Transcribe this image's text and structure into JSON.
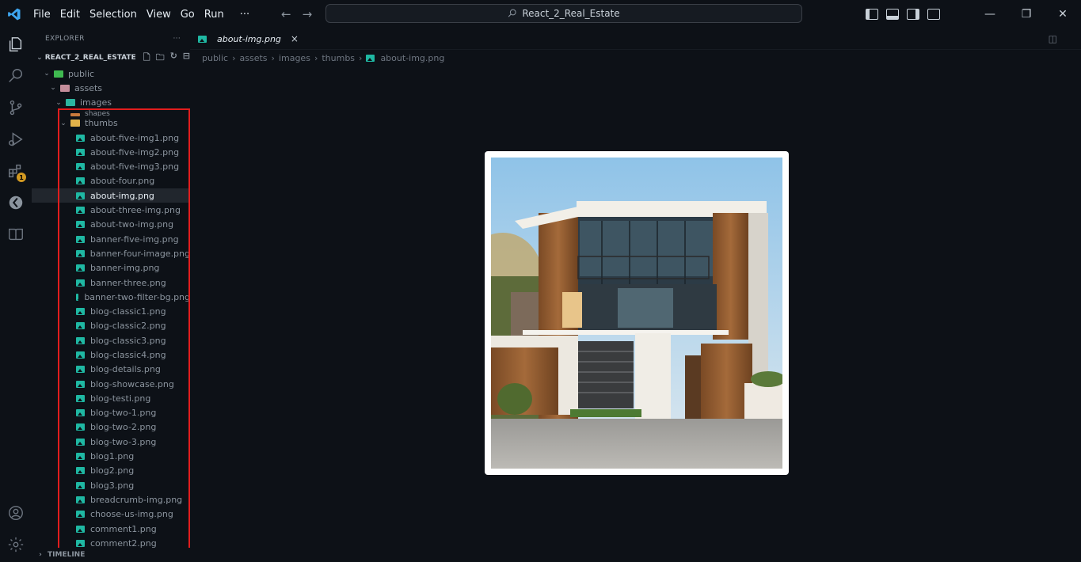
{
  "menu": [
    "File",
    "Edit",
    "Selection",
    "View",
    "Go",
    "Run",
    "···"
  ],
  "search": {
    "text": "React_2_Real_Estate"
  },
  "explorer": {
    "title": "EXPLORER",
    "more": "···",
    "project": "REACT_2_REAL_ESTATE"
  },
  "tree": {
    "public": "public",
    "assets": "assets",
    "images": "images",
    "shapes": "shapes",
    "thumbs": "thumbs",
    "files": [
      "about-five-img1.png",
      "about-five-img2.png",
      "about-five-img3.png",
      "about-four.png",
      "about-img.png",
      "about-three-img.png",
      "about-two-img.png",
      "banner-five-img.png",
      "banner-four-image.png",
      "banner-img.png",
      "banner-three.png",
      "banner-two-filter-bg.png",
      "blog-classic1.png",
      "blog-classic2.png",
      "blog-classic3.png",
      "blog-classic4.png",
      "blog-details.png",
      "blog-showcase.png",
      "blog-testi.png",
      "blog-two-1.png",
      "blog-two-2.png",
      "blog-two-3.png",
      "blog1.png",
      "blog2.png",
      "blog3.png",
      "breadcrumb-img.png",
      "choose-us-img.png",
      "comment1.png",
      "comment2.png"
    ],
    "selected": "about-img.png"
  },
  "timeline": "TIMELINE",
  "tab": {
    "label": "about-img.png",
    "close": "×"
  },
  "breadcrumb": [
    "public",
    "assets",
    "images",
    "thumbs",
    "about-img.png"
  ],
  "extensions_badge": "1",
  "colors": {
    "accent_red": "#e11d1d",
    "image_icon": "#1fb8a3"
  }
}
